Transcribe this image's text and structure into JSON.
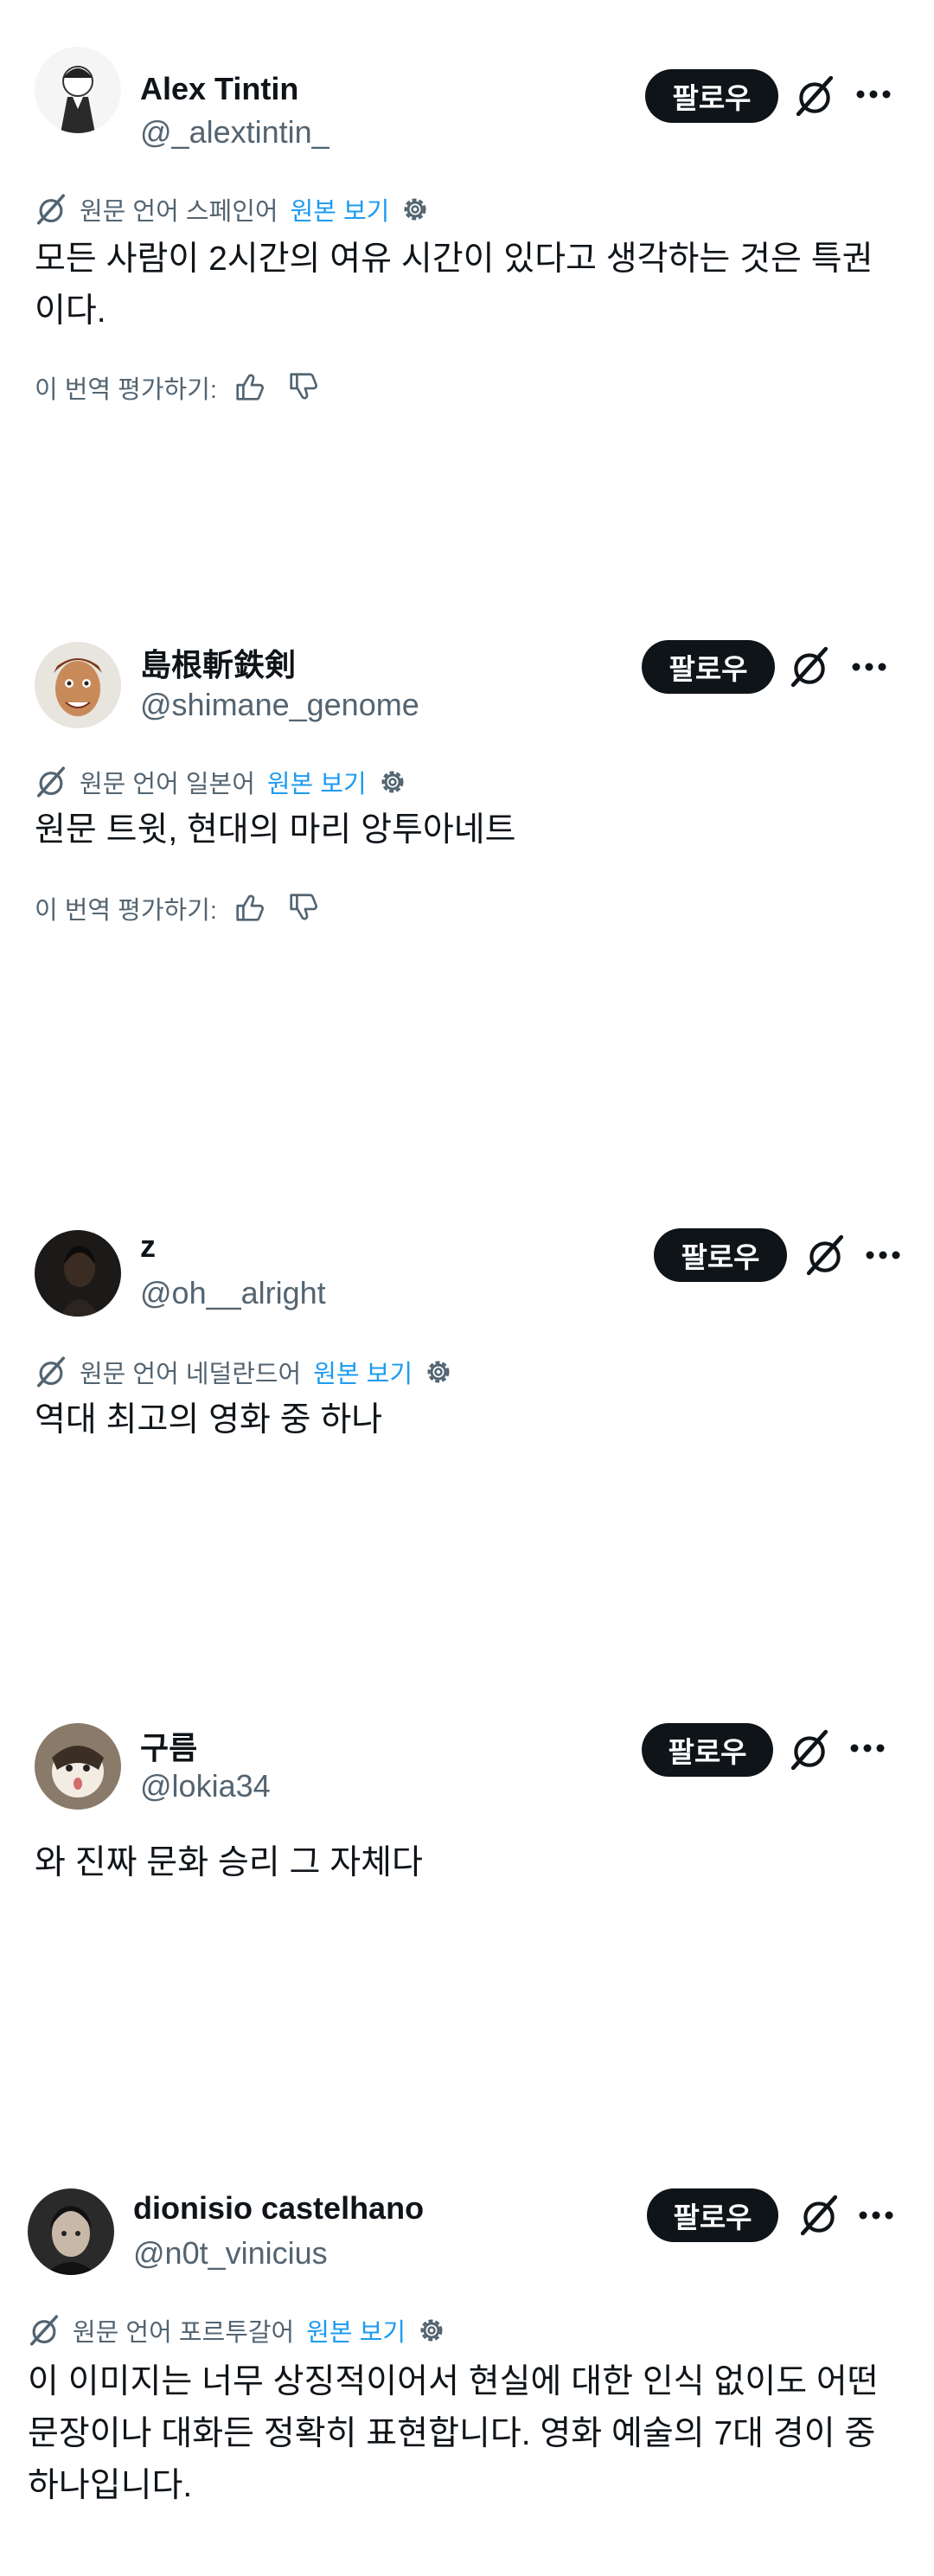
{
  "common": {
    "follow_label": "팔로우",
    "rate_label": "이 번역 평가하기:",
    "show_original": "원본 보기"
  },
  "tweets": [
    {
      "name": "Alex Tintin",
      "handle": "@_alextintin_",
      "translation_note": "원문 언어 스페인어",
      "text": "모든 사람이 2시간의 여유 시간이 있다고 생각하는 것은 특권이다."
    },
    {
      "name": "島根斬鉄剣",
      "handle": "@shimane_genome",
      "translation_note": "원문 언어 일본어",
      "text": "원문 트윗, 현대의 마리 앙투아네트"
    },
    {
      "name": "z",
      "handle": "@oh__alright",
      "translation_note": "원문 언어 네덜란드어",
      "text": "역대 최고의 영화 중 하나"
    },
    {
      "name": "구름",
      "handle": "@lokia34",
      "text": "와 진짜 문화 승리 그 자체다"
    },
    {
      "name": "dionisio castelhano",
      "handle": "@n0t_vinicius",
      "translation_note": "원문 언어 포르투갈어",
      "text": "이 이미지는 너무 상징적이어서 현실에 대한 인식 없이도 어떤 문장이나 대화든 정확히 표현합니다. 영화 예술의 7대 경이 중 하나입니다."
    }
  ],
  "icons": {
    "grok": "grok-icon",
    "more": "more-icon",
    "translate": "translate-icon",
    "gear": "gear-icon",
    "like": "thumbs-up-icon",
    "dislike": "thumbs-down-icon"
  },
  "colors": {
    "text": "#0f1419",
    "secondary": "#536471",
    "link": "#1d9bf0",
    "button": "#0f1419"
  }
}
